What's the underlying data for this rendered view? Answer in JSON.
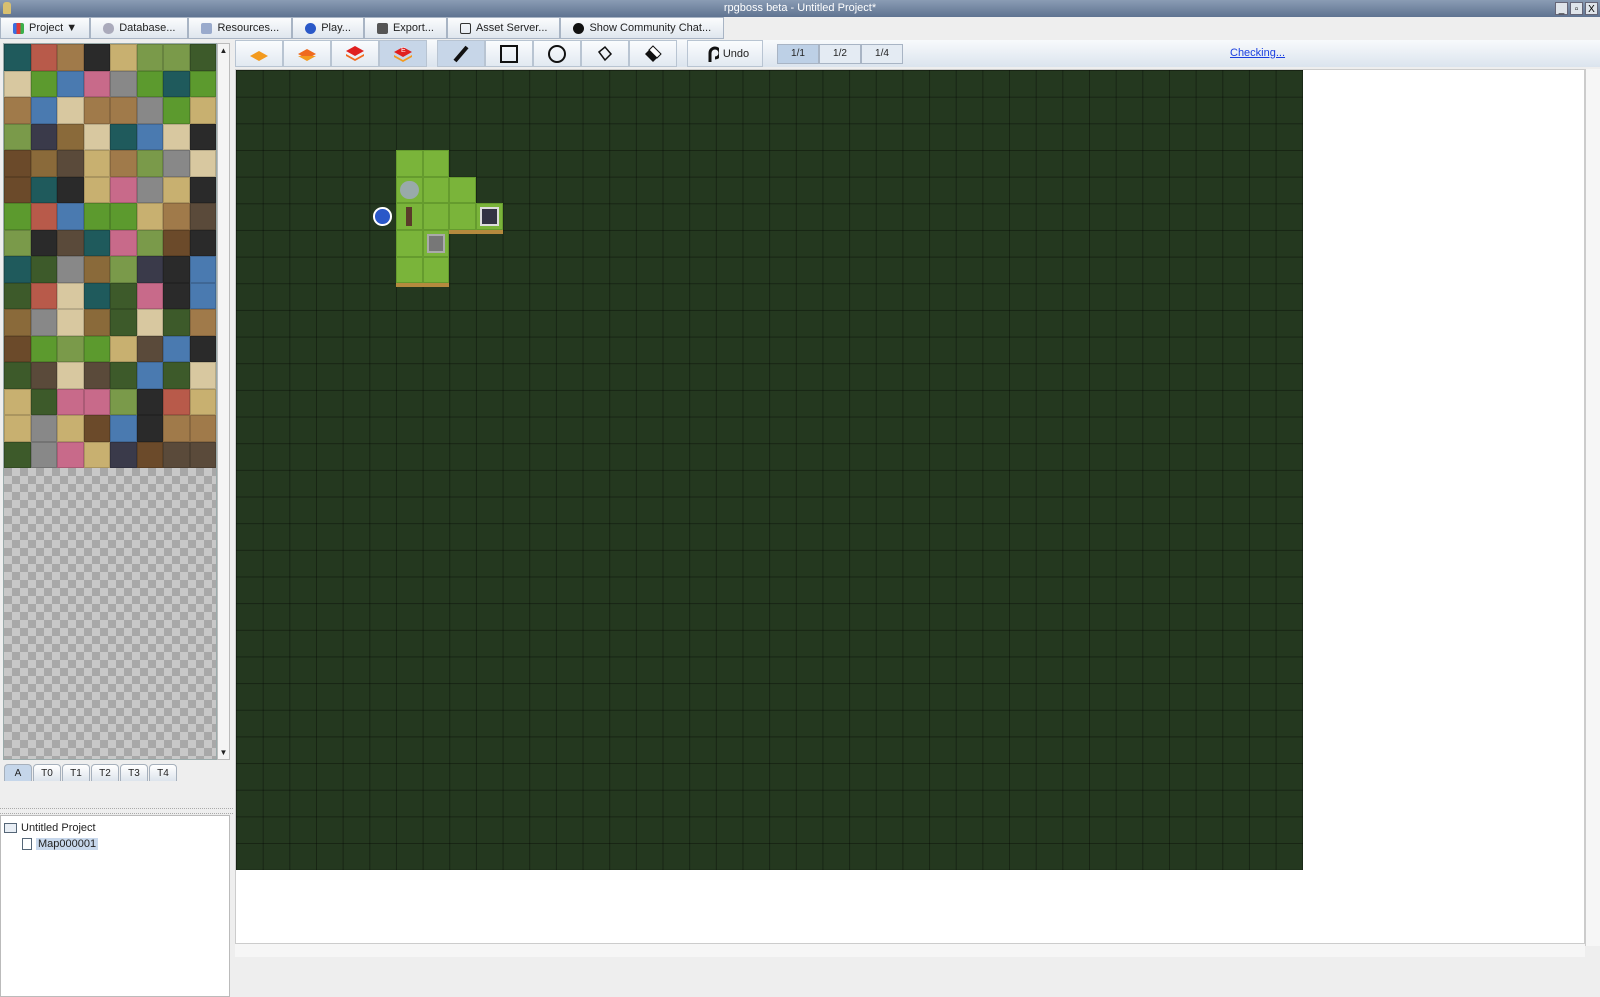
{
  "window": {
    "title": "rpgboss beta - Untitled Project*",
    "controls": [
      "_",
      "▫",
      "X"
    ]
  },
  "menu": [
    {
      "label": "Project ▼",
      "icon": "project-icon"
    },
    {
      "label": "Database...",
      "icon": "database-icon"
    },
    {
      "label": "Resources...",
      "icon": "resources-icon"
    },
    {
      "label": "Play...",
      "icon": "play-icon"
    },
    {
      "label": "Export...",
      "icon": "export-icon"
    },
    {
      "label": "Asset Server...",
      "icon": "asset-server-icon"
    },
    {
      "label": "Show Community Chat...",
      "icon": "chat-icon"
    }
  ],
  "toolbar": {
    "layers": [
      "layer-bottom",
      "layer-middle",
      "layer-top",
      "layer-events"
    ],
    "events_badge": "E",
    "tools": [
      "pencil",
      "rectangle",
      "ellipse",
      "fill",
      "eraser"
    ],
    "undo": "Undo",
    "zoom": [
      "1/1",
      "1/2",
      "1/4"
    ],
    "status": "Checking..."
  },
  "palette_tabs": [
    "A",
    "T0",
    "T1",
    "T2",
    "T3",
    "T4"
  ],
  "tree": {
    "root": "Untitled Project",
    "maps": [
      "Map000001"
    ]
  }
}
